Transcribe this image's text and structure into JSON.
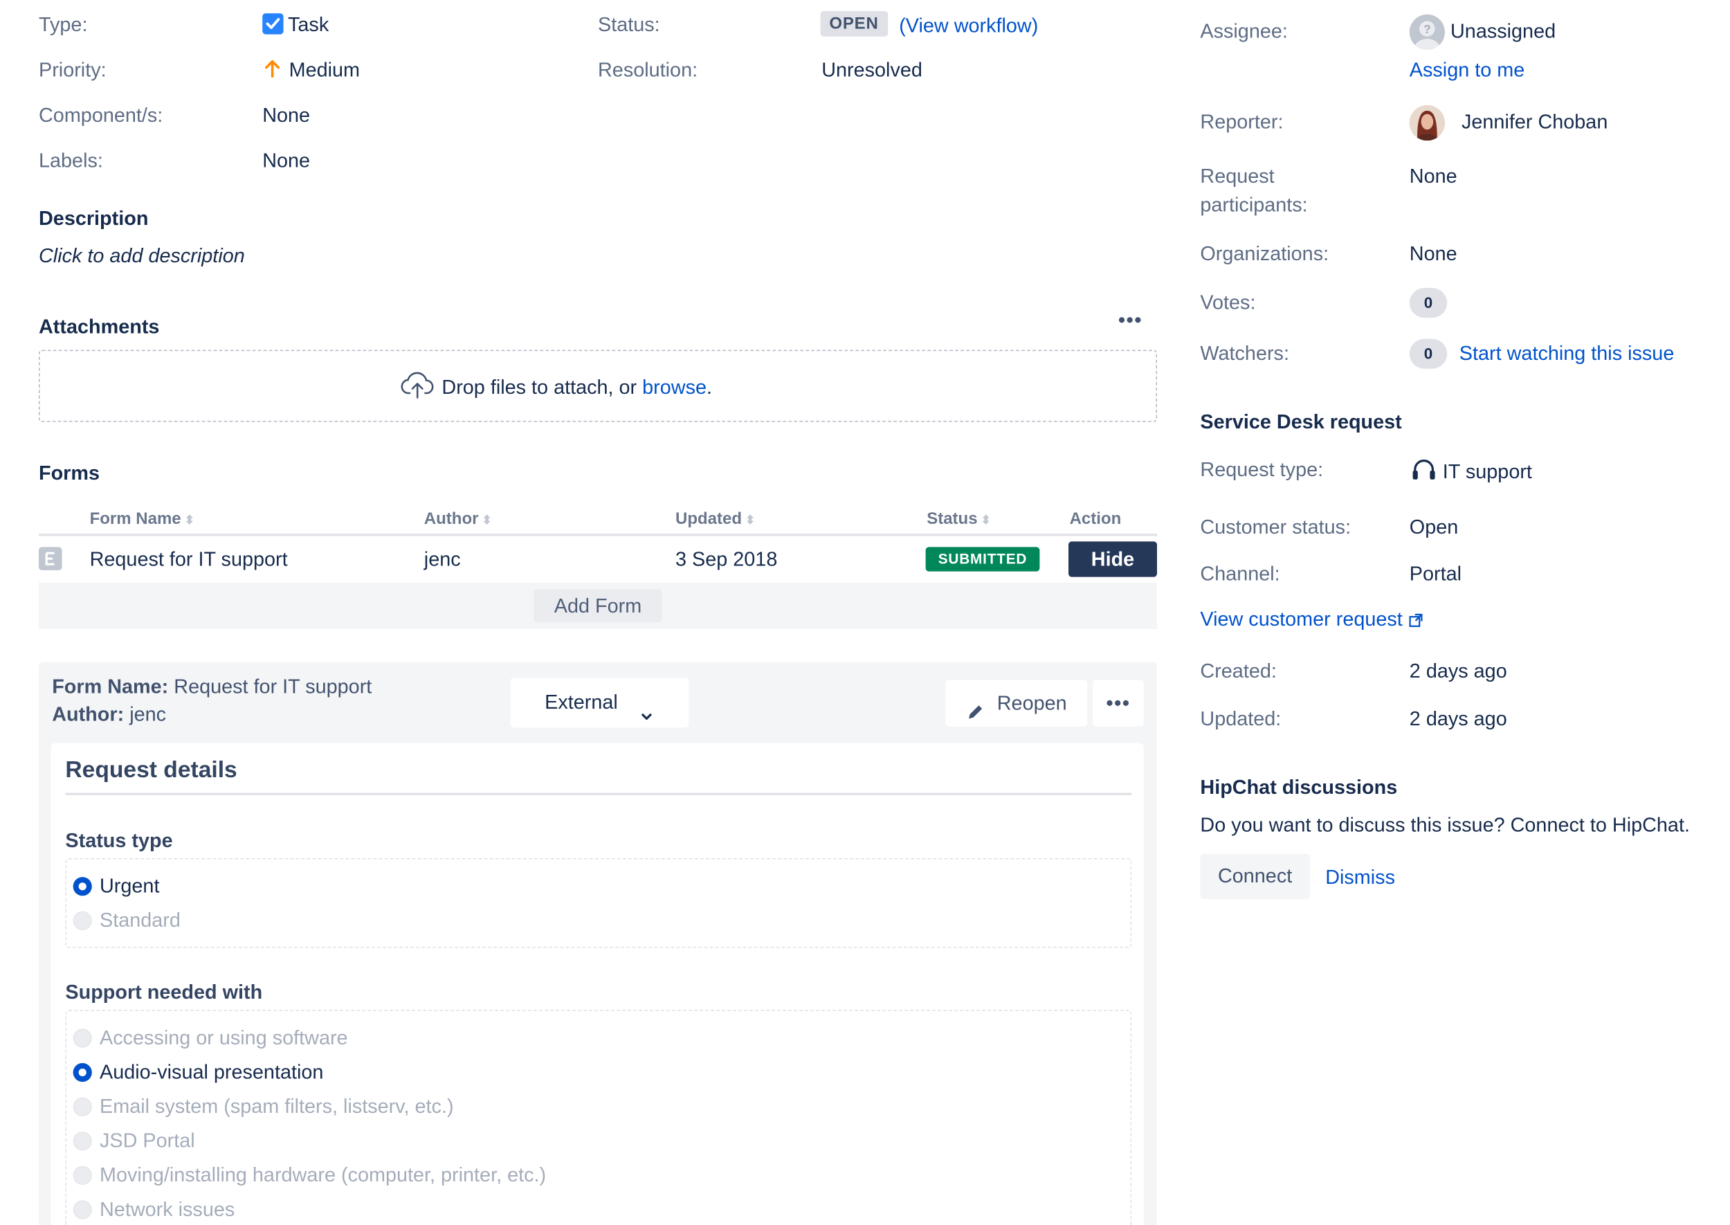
{
  "details": {
    "type_label": "Type:",
    "type_value": "Task",
    "priority_label": "Priority:",
    "priority_value": "Medium",
    "components_label": "Component/s:",
    "components_value": "None",
    "labels_label": "Labels:",
    "labels_value": "None",
    "status_label": "Status:",
    "status_value": "OPEN",
    "workflow_open": "(",
    "workflow_link": "View workflow",
    "workflow_close": ")",
    "resolution_label": "Resolution:",
    "resolution_value": "Unresolved"
  },
  "description": {
    "heading": "Description",
    "placeholder": "Click to add description"
  },
  "attachments": {
    "heading": "Attachments",
    "more": "•••",
    "drop_text": "Drop files to attach, or ",
    "browse": "browse",
    "period": "."
  },
  "forms": {
    "heading": "Forms",
    "columns": [
      "Form Name",
      "Author",
      "Updated",
      "Status",
      "Action"
    ],
    "rows": [
      {
        "name": "Request for IT support",
        "author": "jenc",
        "updated": "3 Sep 2018",
        "status": "SUBMITTED",
        "action": "Hide"
      }
    ],
    "add_form": "Add Form"
  },
  "form_detail": {
    "name_label": "Form Name:",
    "name_value": "Request for IT support",
    "author_label": "Author:",
    "author_value": "jenc",
    "visibility": "External",
    "reopen": "Reopen",
    "more": "•••",
    "card_title": "Request details",
    "status_type_label": "Status type",
    "status_type_options": [
      {
        "label": "Urgent",
        "selected": true
      },
      {
        "label": "Standard",
        "selected": false
      }
    ],
    "support_label": "Support needed with",
    "support_options": [
      {
        "label": "Accessing or using software",
        "selected": false
      },
      {
        "label": "Audio-visual presentation",
        "selected": true
      },
      {
        "label": "Email system (spam filters, listserv, etc.)",
        "selected": false
      },
      {
        "label": "JSD Portal",
        "selected": false
      },
      {
        "label": "Moving/installing hardware (computer, printer, etc.)",
        "selected": false
      },
      {
        "label": "Network issues",
        "selected": false
      }
    ]
  },
  "people": {
    "assignee_label": "Assignee:",
    "assignee_value": "Unassigned",
    "assign_to_me": "Assign to me",
    "reporter_label": "Reporter:",
    "reporter_value": "Jennifer Choban",
    "participants_label_1": "Request",
    "participants_label_2": "participants:",
    "participants_value": "None",
    "organizations_label": "Organizations:",
    "organizations_value": "None",
    "votes_label": "Votes:",
    "votes_value": "0",
    "watchers_label": "Watchers:",
    "watchers_value": "0",
    "watch_link": "Start watching this issue"
  },
  "service_desk": {
    "heading": "Service Desk request",
    "request_type_label": "Request type:",
    "request_type_value": "IT support",
    "customer_status_label": "Customer status:",
    "customer_status_value": "Open",
    "channel_label": "Channel:",
    "channel_value": "Portal",
    "view_request": "View customer request"
  },
  "dates": {
    "created_label": "Created:",
    "created_value": "2 days ago",
    "updated_label": "Updated:",
    "updated_value": "2 days ago"
  },
  "hipchat": {
    "heading": "HipChat discussions",
    "prompt": "Do you want to discuss this issue? Connect to HipChat.",
    "connect": "Connect",
    "dismiss": "Dismiss"
  },
  "colors": {
    "link": "#0052cc",
    "submitted": "#00875a",
    "hide_button": "#253858",
    "priority_arrow": "#ff8b00",
    "task_icon": "#2684ff",
    "radio_selected": "#0052cc"
  }
}
